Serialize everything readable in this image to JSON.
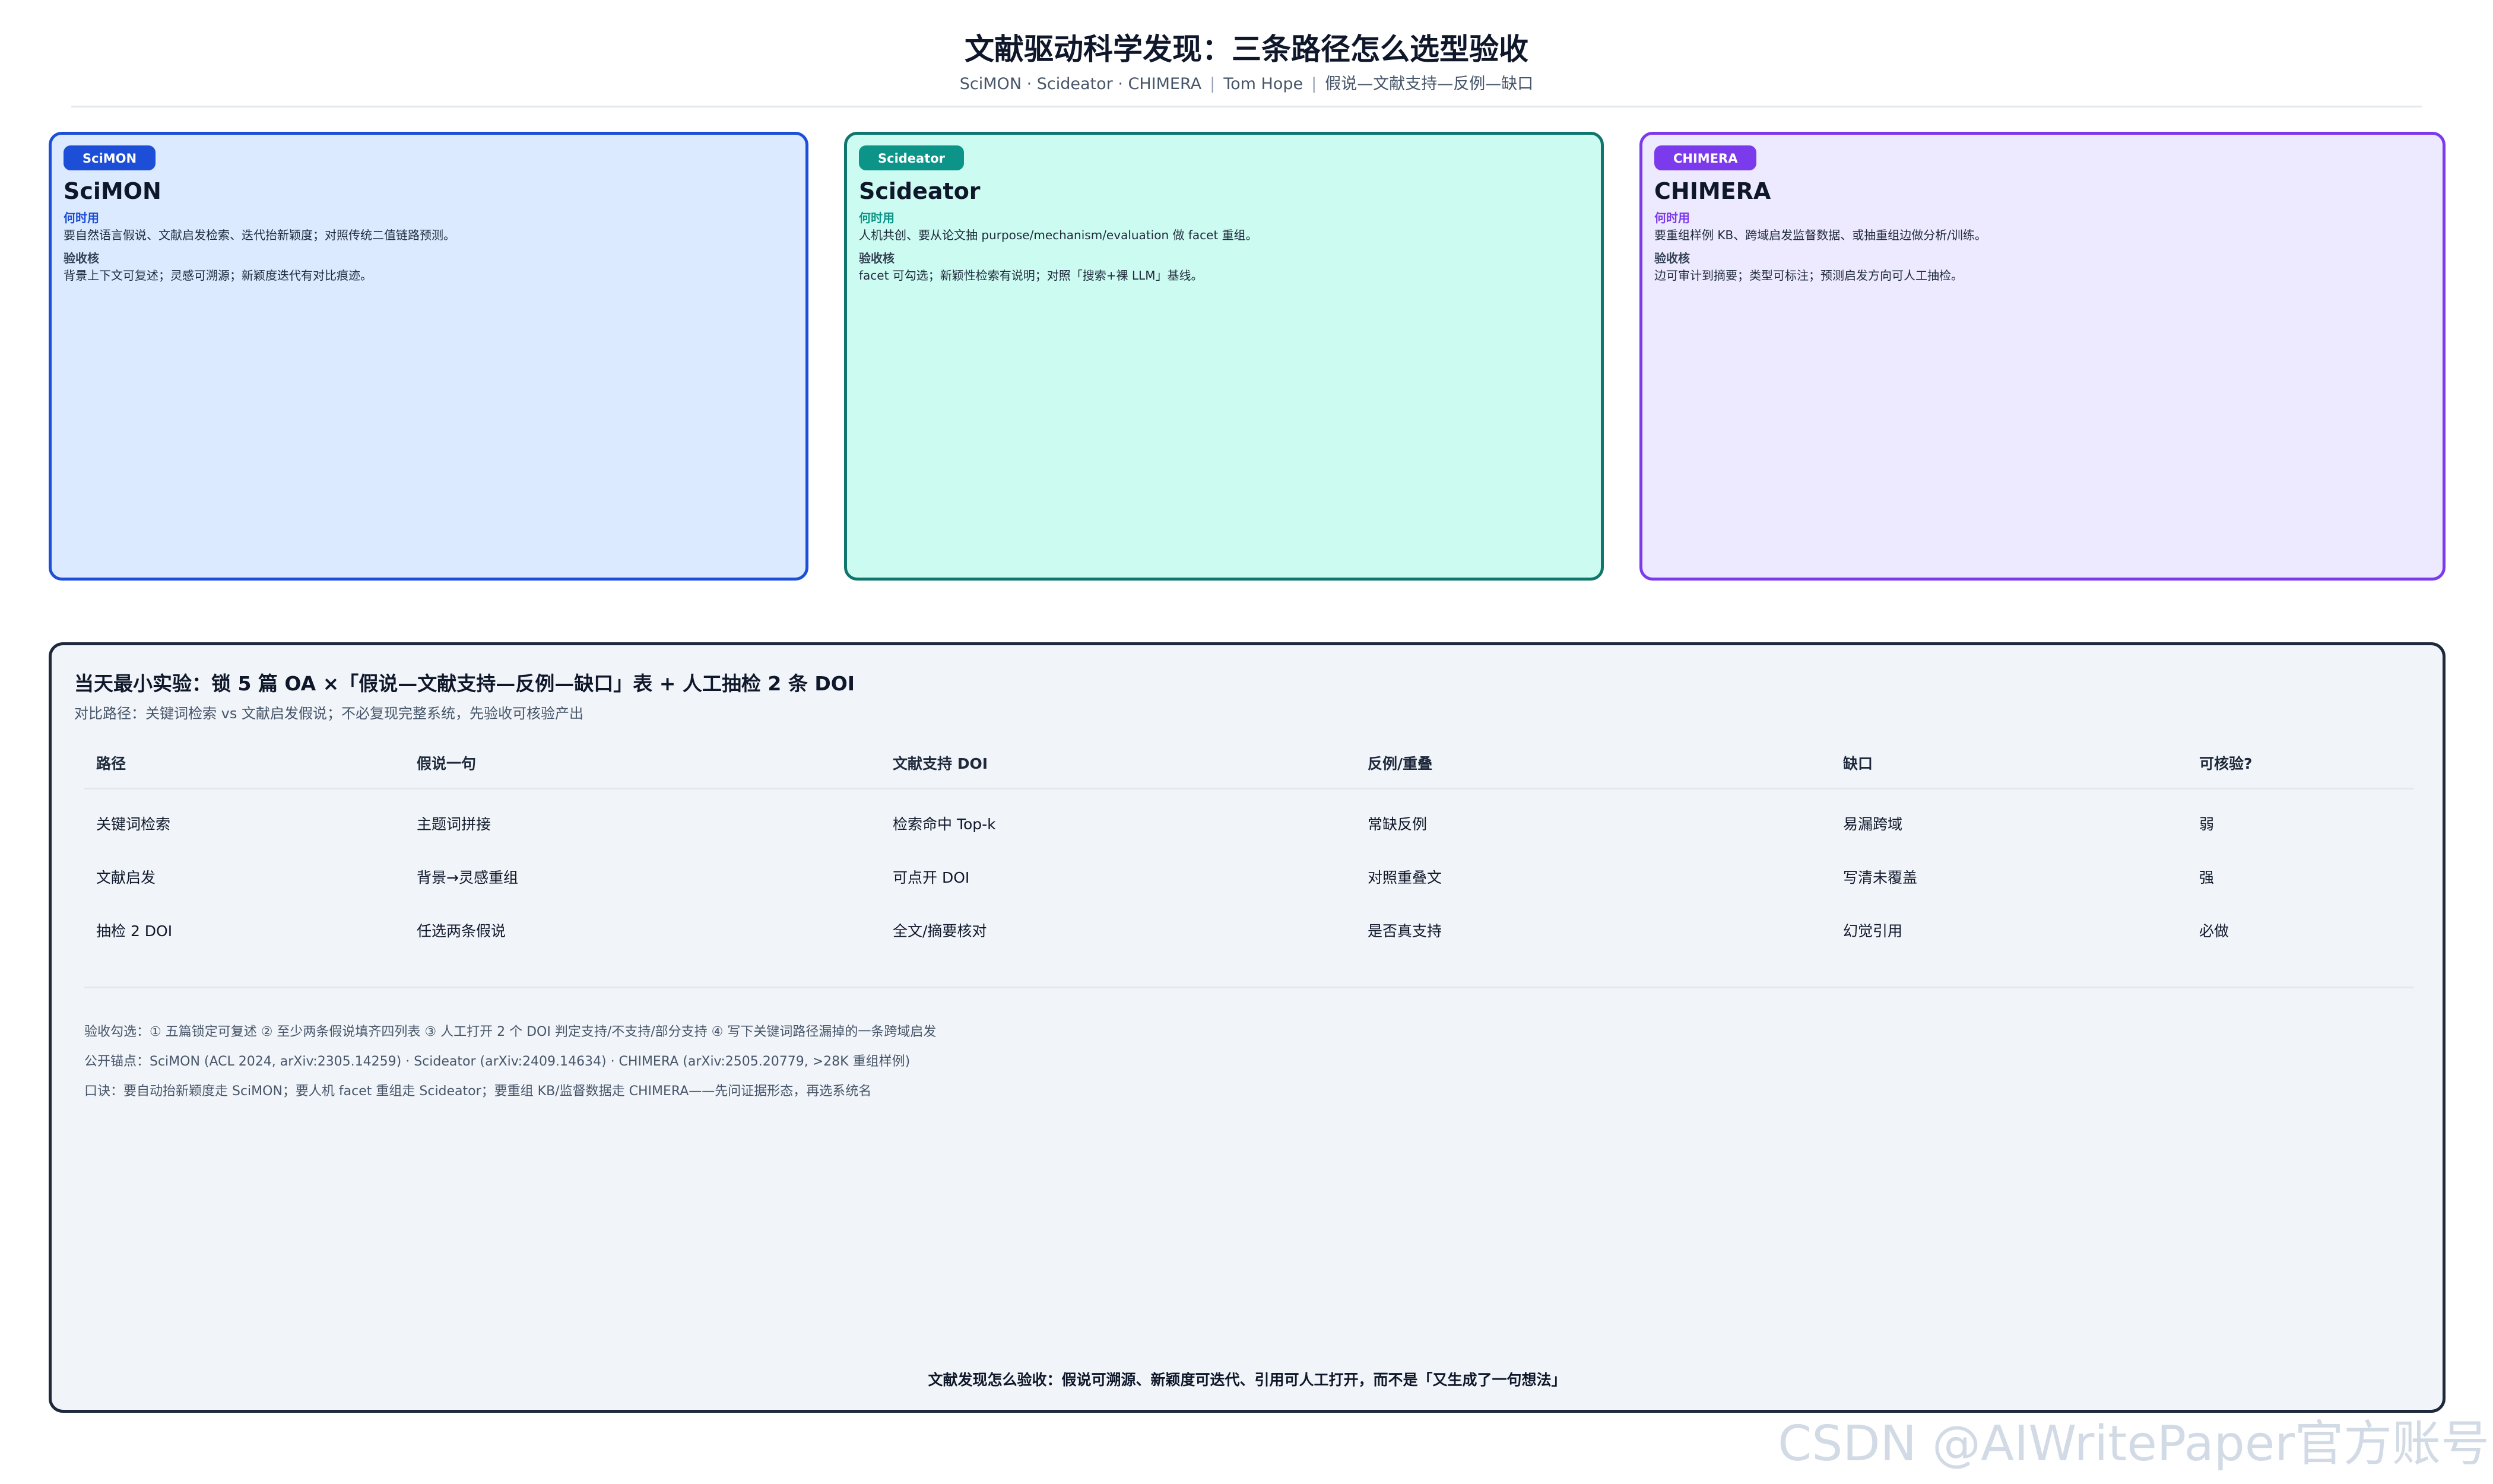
{
  "header": {
    "title": "文献驱动科学发现：三条路径怎么选型验收",
    "subtitle_methods": "SciMON · Scideator · CHIMERA",
    "subtitle_author": "Tom Hope",
    "subtitle_flow": "假说—文献支持—反例—缺口"
  },
  "cards": [
    {
      "tag": "SciMON",
      "name": "SciMON",
      "when_label": "何时用",
      "when_text": "要自然语言假说、文献启发检索、迭代抬新颖度；对照传统二值链路预测。",
      "check_label": "验收核",
      "check_text": "背景上下文可复述；灵感可溯源；新颖度迭代有对比痕迹。",
      "accent": "#1d4ed8",
      "bg": "#dbeafe",
      "border": "#1d4ed8"
    },
    {
      "tag": "Scideator",
      "name": "Scideator",
      "when_label": "何时用",
      "when_text": "人机共创、要从论文抽 purpose/mechanism/evaluation 做 facet 重组。",
      "check_label": "验收核",
      "check_text": "facet 可勾选；新颖性检索有说明；对照「搜索+裸 LLM」基线。",
      "accent": "#0d9488",
      "bg": "#ccfbf1",
      "border": "#0f766e"
    },
    {
      "tag": "CHIMERA",
      "name": "CHIMERA",
      "when_label": "何时用",
      "when_text": "要重组样例 KB、跨域启发监督数据、或抽重组边做分析/训练。",
      "check_label": "验收核",
      "check_text": "边可审计到摘要；类型可标注；预测启发方向可人工抽检。",
      "accent": "#7c3aed",
      "bg": "#ede9fe",
      "border": "#7c3aed"
    }
  ],
  "panel": {
    "title": "当天最小实验：锁 5 篇 OA ×「假说—文献支持—反例—缺口」表 + 人工抽检 2 条 DOI",
    "subtitle": "对比路径：关键词检索 vs 文献启发假说；不必复现完整系统，先验收可核验产出",
    "columns": [
      "路径",
      "假说一句",
      "文献支持 DOI",
      "反例/重叠",
      "缺口",
      "可核验?"
    ],
    "rows": [
      [
        "关键词检索",
        "主题词拼接",
        "检索命中 Top-k",
        "常缺反例",
        "易漏跨域",
        "弱"
      ],
      [
        "文献启发",
        "背景→灵感重组",
        "可点开 DOI",
        "对照重叠文",
        "写清未覆盖",
        "强"
      ],
      [
        "抽检 2 DOI",
        "任选两条假说",
        "全文/摘要核对",
        "是否真支持",
        "幻觉引用",
        "必做"
      ]
    ],
    "notes": [
      "验收勾选：① 五篇锁定可复述 ② 至少两条假说填齐四列表 ③ 人工打开 2 个 DOI 判定支持/不支持/部分支持 ④ 写下关键词路径漏掉的一条跨域启发",
      "公开锚点：SciMON (ACL 2024, arXiv:2305.14259) · Scideator (arXiv:2409.14634) · CHIMERA (arXiv:2505.20779, >28K 重组样例)",
      "口诀：要自动抬新颖度走 SciMON；要人机 facet 重组走 Scideator；要重组 KB/监督数据走 CHIMERA——先问证据形态，再选系统名"
    ],
    "footer": "文献发现怎么验收：假说可溯源、新颖度可迭代、引用可人工打开，而不是「又生成了一句想法」"
  },
  "watermark": "CSDN @AIWritePaper官方账号"
}
